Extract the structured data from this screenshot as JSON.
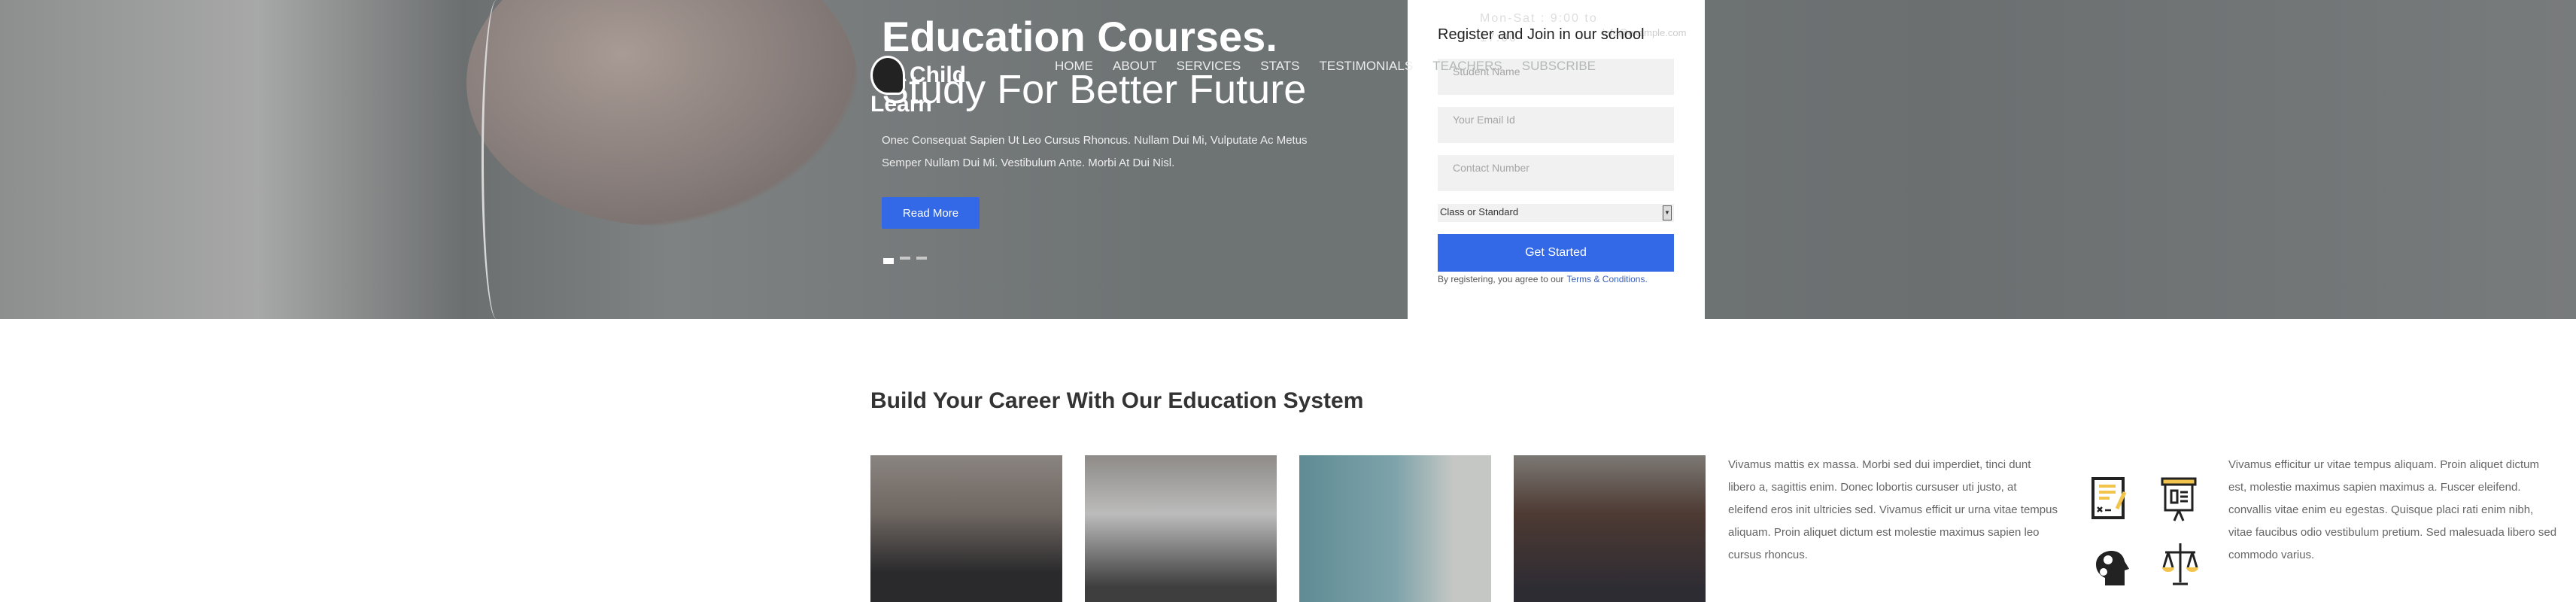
{
  "hero": {
    "title": "Education Courses.",
    "subtitle": "Study For Better Future",
    "text": "Onec Consequat Sapien Ut Leo Cursus Rhoncus. Nullam Dui Mi, Vulputate Ac Metus Semper Nullam Dui Mi. Vestibulum Ante. Morbi At Dui Nisl.",
    "read_more": "Read More",
    "slide_active": 1,
    "slide_count": 3
  },
  "logo": {
    "line1": "Child",
    "line2": "Learn",
    "icon": "head-gears-icon"
  },
  "nav": {
    "items": [
      "HOME",
      "ABOUT",
      "SERVICES",
      "STATS",
      "TESTIMONIALS",
      "TEACHERS",
      "SUBSCRIBE"
    ]
  },
  "topbar": {
    "hours": "Mon-Sat : 9:00 to 17:00",
    "email": "info@example.com"
  },
  "form": {
    "title": "Register and Join in our school",
    "name_placeholder": "Student Name",
    "email_placeholder": "Your Email Id",
    "phone_placeholder": "Contact Number",
    "class_select": "Class or Standard",
    "submit": "Get Started",
    "terms_prefix": "By registering, you agree to our",
    "terms_link": "Terms & Conditions."
  },
  "section": {
    "title": "Build Your Career With Our Education System",
    "text_left": "Vivamus mattis ex massa. Morbi sed dui imperdiet, tinci dunt libero a, sagittis enim. Donec lobortis cursuser uti justo, at eleifend eros init ultricies sed. Vivamus efficit ur urna vitae tempus aliquam. Proin aliquet dictum est molestie maximus sapien leo cursus rhoncus.",
    "text_right": "Vivamus efficitur ur vitae tempus aliquam. Proin aliquet dictum est, molestie maximus sapien maximus a. Fuscer eleifend. convallis vitae enim eu egestas. Quisque placi rati enim nibh, vitae faucibus odio vestibulum pretium. Sed malesuada libero sed commodo varius.",
    "icons": [
      "exam-paper-icon",
      "presentation-board-icon",
      "head-gears-icon",
      "scales-icon"
    ]
  },
  "colors": {
    "accent": "#3369e7",
    "icon_yellow": "#f2c44b"
  }
}
